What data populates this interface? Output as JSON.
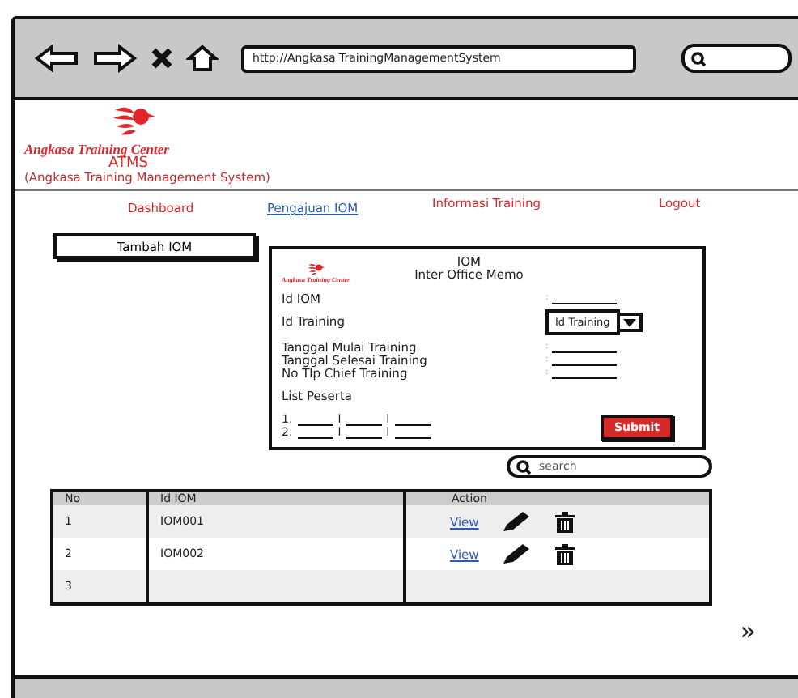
{
  "browser": {
    "url": "http://Angkasa TrainingManagementSystem"
  },
  "header": {
    "logo_text": "Angkasa Training Center",
    "acronym": "ATMS",
    "subtitle": "(Angkasa Training Management System)"
  },
  "nav": [
    {
      "label": "Dashboard",
      "selected": false
    },
    {
      "label": "Pengajuan IOM",
      "selected": true
    },
    {
      "label": "Informasi Training",
      "selected": false
    },
    {
      "label": "Logout",
      "selected": false
    }
  ],
  "add_button": "Tambah IOM",
  "form": {
    "logo_text": "Angkasa Training Center",
    "title": "IOM",
    "subtitle": "Inter Office Memo",
    "separator": ":",
    "field_groups": [
      [
        {
          "kind": "text",
          "label": "Id IOM"
        },
        {
          "kind": "select",
          "label": "Id Training",
          "value": "Id Training"
        }
      ],
      [
        {
          "kind": "text",
          "label": "Tanggal Mulai Training"
        },
        {
          "kind": "text",
          "label": "Tanggal Selesai Training"
        },
        {
          "kind": "text",
          "label": "No Tlp Chief Training"
        }
      ]
    ],
    "list_label": "List Peserta",
    "list_rows": [
      {
        "number": "1.",
        "dividers": [
          "l",
          "l"
        ]
      },
      {
        "number": "2.",
        "dividers": [
          "l",
          "l"
        ]
      }
    ],
    "submit": "Submit"
  },
  "search": {
    "placeholder": "search"
  },
  "table": {
    "columns": [
      "No",
      "Id IOM",
      "Action"
    ],
    "rows": [
      {
        "no": "1",
        "id_iom": "IOM001",
        "link": "View",
        "actions": true
      },
      {
        "no": "2",
        "id_iom": "IOM002",
        "link": "View",
        "actions": true
      },
      {
        "no": "3",
        "actions": false
      }
    ]
  },
  "pager": "»"
}
